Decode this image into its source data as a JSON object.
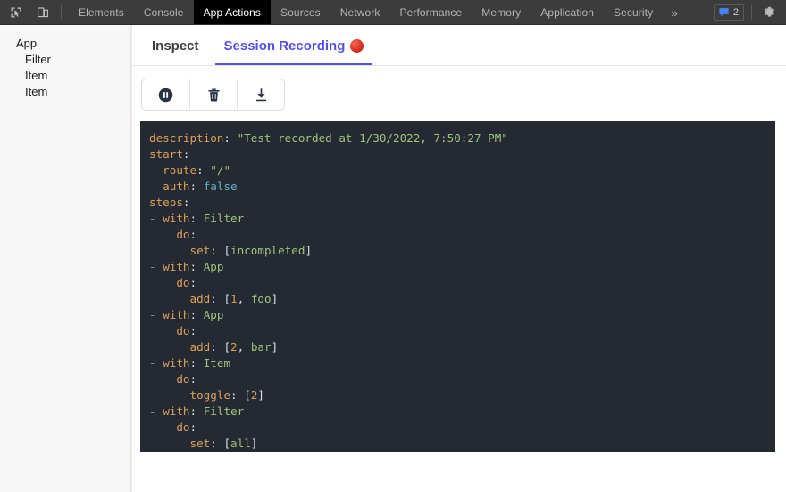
{
  "devtools": {
    "icons": [
      {
        "name": "inspect-element-icon",
        "label": "Inspect element"
      },
      {
        "name": "device-toolbar-icon",
        "label": "Toggle device toolbar"
      }
    ],
    "tabs": [
      {
        "label": "Elements",
        "active": false
      },
      {
        "label": "Console",
        "active": false
      },
      {
        "label": "App Actions",
        "active": true
      },
      {
        "label": "Sources",
        "active": false
      },
      {
        "label": "Network",
        "active": false
      },
      {
        "label": "Performance",
        "active": false
      },
      {
        "label": "Memory",
        "active": false
      },
      {
        "label": "Application",
        "active": false
      },
      {
        "label": "Security",
        "active": false
      }
    ],
    "overflow_label": "»",
    "issues_count": "2",
    "issues_icon": "issues-message-icon",
    "settings_icon": "gear-icon",
    "accent_active_tab_bg": "#000000",
    "toolbar_bg": "#3c3c3c"
  },
  "sidebar": {
    "tree": [
      {
        "label": "App",
        "depth": 0
      },
      {
        "label": "Filter",
        "depth": 1
      },
      {
        "label": "Item",
        "depth": 1
      },
      {
        "label": "Item",
        "depth": 1
      }
    ]
  },
  "panel": {
    "subtabs": [
      {
        "label": "Inspect",
        "active": false,
        "badge": null
      },
      {
        "label": "Session Recording",
        "active": true,
        "badge": "recording-dot-icon"
      }
    ],
    "active_color": "#5350e8",
    "toolbar_buttons": [
      {
        "name": "pause-recording-button",
        "icon": "pause-circle-icon",
        "label": "Pause"
      },
      {
        "name": "delete-recording-button",
        "icon": "trash-icon",
        "label": "Delete"
      },
      {
        "name": "download-recording-button",
        "icon": "download-icon",
        "label": "Download"
      }
    ]
  },
  "recording": {
    "language": "yaml",
    "background": "#252931",
    "lines": [
      {
        "indent": 0,
        "dash": false,
        "key": "description",
        "value": "\"Test recorded at 1/30/2022, 7:50:27 PM\"",
        "value_kind": "string"
      },
      {
        "indent": 0,
        "dash": false,
        "key": "start",
        "value": "",
        "value_kind": "none"
      },
      {
        "indent": 1,
        "dash": false,
        "key": "route",
        "value": "\"/\"",
        "value_kind": "string"
      },
      {
        "indent": 1,
        "dash": false,
        "key": "auth",
        "value": "false",
        "value_kind": "bool"
      },
      {
        "indent": 0,
        "dash": false,
        "key": "steps",
        "value": "",
        "value_kind": "none"
      },
      {
        "indent": 1,
        "dash": true,
        "key": "with",
        "value": "Filter",
        "value_kind": "plain"
      },
      {
        "indent": 2,
        "dash": false,
        "key": "do",
        "value": "",
        "value_kind": "none"
      },
      {
        "indent": 3,
        "dash": false,
        "key": "set",
        "value": "[incompleted]",
        "value_kind": "list"
      },
      {
        "indent": 1,
        "dash": true,
        "key": "with",
        "value": "App",
        "value_kind": "plain"
      },
      {
        "indent": 2,
        "dash": false,
        "key": "do",
        "value": "",
        "value_kind": "none"
      },
      {
        "indent": 3,
        "dash": false,
        "key": "add",
        "value": "[1, foo]",
        "value_kind": "list"
      },
      {
        "indent": 1,
        "dash": true,
        "key": "with",
        "value": "App",
        "value_kind": "plain"
      },
      {
        "indent": 2,
        "dash": false,
        "key": "do",
        "value": "",
        "value_kind": "none"
      },
      {
        "indent": 3,
        "dash": false,
        "key": "add",
        "value": "[2, bar]",
        "value_kind": "list"
      },
      {
        "indent": 1,
        "dash": true,
        "key": "with",
        "value": "Item",
        "value_kind": "plain"
      },
      {
        "indent": 2,
        "dash": false,
        "key": "do",
        "value": "",
        "value_kind": "none"
      },
      {
        "indent": 3,
        "dash": false,
        "key": "toggle",
        "value": "[2]",
        "value_kind": "list"
      },
      {
        "indent": 1,
        "dash": true,
        "key": "with",
        "value": "Filter",
        "value_kind": "plain"
      },
      {
        "indent": 2,
        "dash": false,
        "key": "do",
        "value": "",
        "value_kind": "none"
      },
      {
        "indent": 3,
        "dash": false,
        "key": "set",
        "value": "[all]",
        "value_kind": "list"
      }
    ],
    "colors": {
      "key": "#d9a05b",
      "string": "#9cc47f",
      "plain": "#9cc47f",
      "bool": "#62b0c4",
      "number": "#d9a05b",
      "dash": "#6699cc",
      "punct": "#d8dee9"
    }
  }
}
